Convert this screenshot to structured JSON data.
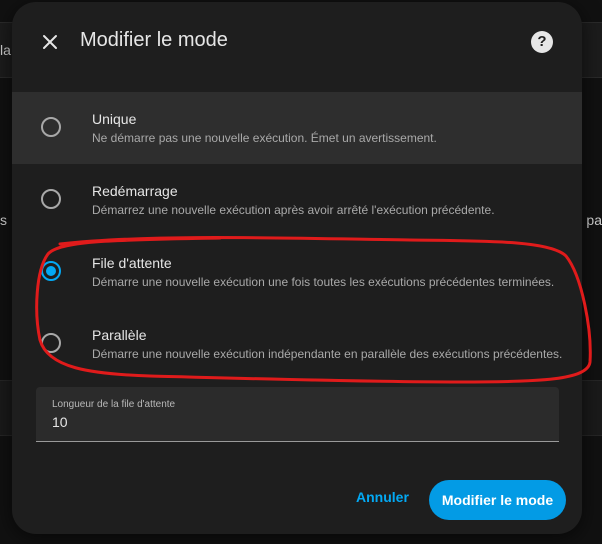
{
  "background": {
    "fragment_left_top": "la",
    "fragment_left_mid": "s",
    "fragment_right_mid": "t, pa"
  },
  "dialog": {
    "title": "Modifier le mode",
    "close_icon": "close-icon",
    "help_icon": "help-circle-icon",
    "help_glyph": "?"
  },
  "options": [
    {
      "title": "Unique",
      "description": "Ne démarre pas une nouvelle exécution. Émet un avertissement.",
      "selected": false
    },
    {
      "title": "Redémarrage",
      "description": "Démarrez une nouvelle exécution après avoir arrêté l'exécution précédente.",
      "selected": false
    },
    {
      "title": "File d'attente",
      "description": "Démarre une nouvelle exécution une fois toutes les exécutions précédentes terminées.",
      "selected": true
    },
    {
      "title": "Parallèle",
      "description": "Démarre une nouvelle exécution indépendante en parallèle des exécutions précédentes.",
      "selected": false
    }
  ],
  "queue_field": {
    "label": "Longueur de la file d'attente",
    "value": "10"
  },
  "actions": {
    "cancel_label": "Annuler",
    "confirm_label": "Modifier le mode"
  },
  "colors": {
    "accent": "#03a9f4",
    "annotation": "#e01b1b"
  }
}
